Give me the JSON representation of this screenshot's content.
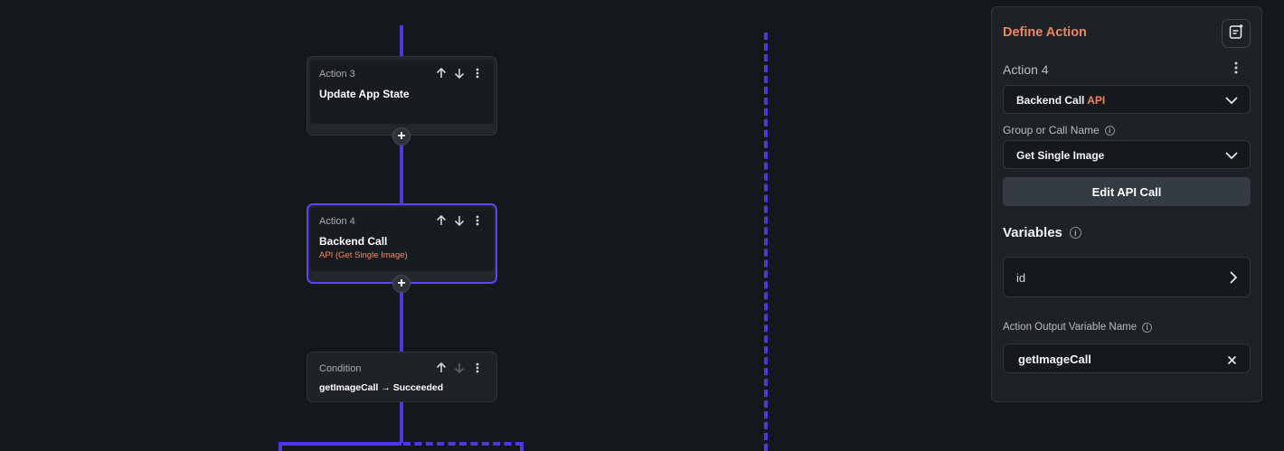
{
  "canvas": {
    "actions": [
      {
        "label": "Action 3",
        "title": "Update App State",
        "subtitle": ""
      },
      {
        "label": "Action 4",
        "title": "Backend Call",
        "subtitle": "API (Get Single Image)"
      }
    ],
    "condition": {
      "label": "Condition",
      "expression": "getImageCall → Succeeded"
    },
    "icons": {
      "up": "arrow-up-icon",
      "down": "arrow-down-icon",
      "more": "more-vertical-icon",
      "add": "plus-icon"
    },
    "add_symbol": "+"
  },
  "panel": {
    "title": "Define Action",
    "action_name": "Action 4",
    "action_type": {
      "value": "Backend Call",
      "tag": "API"
    },
    "group_label": "Group or Call Name",
    "group_value": "Get Single Image",
    "edit_button": "Edit API Call",
    "variables_title": "Variables",
    "variables": [
      {
        "name": "id"
      }
    ],
    "output_label": "Action Output Variable Name",
    "output_value": "getImageCall",
    "info_symbol": "i",
    "icons": {
      "notes": "notes-icon",
      "kebab": "more-vertical-icon",
      "chevron": "chevron-down-icon",
      "chevron_right": "chevron-right-icon",
      "clear": "close-icon"
    }
  },
  "colors": {
    "background": "#14171b",
    "connector": "#4b3adf",
    "accent": "#f0855e",
    "selected_border": "#5a49f0"
  }
}
